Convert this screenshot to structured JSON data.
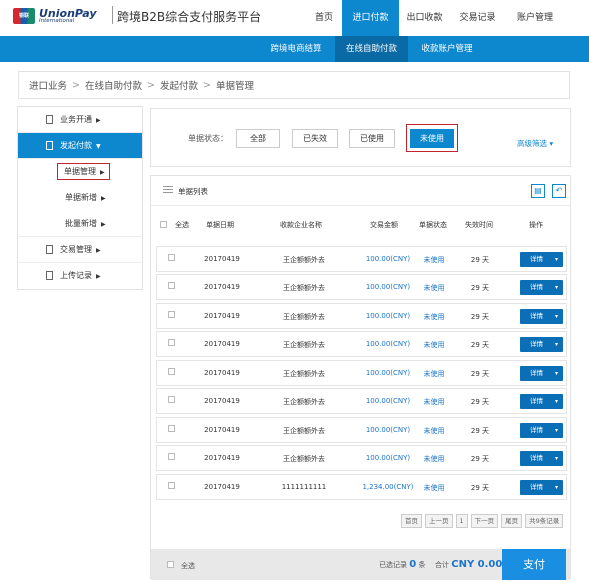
{
  "header": {
    "logo_badge": "银联",
    "logo_line1": "UnionPay",
    "logo_line2": "International",
    "site_title": "跨境B2B综合支付服务平台",
    "nav": [
      "首页",
      "进口付款",
      "出口收款",
      "交易记录",
      "账户管理"
    ],
    "active_nav": "进口付款"
  },
  "subnav": {
    "items": [
      "跨境电商结算",
      "在线自助付款",
      "收款账户管理"
    ],
    "active": "在线自助付款"
  },
  "breadcrumb": [
    "进口业务",
    "在线自助付款",
    "发起付款",
    "单据管理"
  ],
  "sidebar": {
    "items": [
      {
        "label": "业务开通",
        "caret": "▶"
      },
      {
        "label": "发起付款",
        "caret": "▼"
      },
      {
        "label": "单据管理",
        "caret": "▶"
      },
      {
        "label": "单据新增",
        "caret": "▶"
      },
      {
        "label": "批量新增",
        "caret": "▶"
      },
      {
        "label": "交易管理",
        "caret": "▶"
      },
      {
        "label": "上传记录",
        "caret": "▶"
      }
    ]
  },
  "filter": {
    "label": "单据状态：",
    "buttons": [
      "全部",
      "已失效",
      "已使用",
      "未使用"
    ],
    "selected": "未使用",
    "advanced": "高级筛选 ▾"
  },
  "table": {
    "title": "单据列表",
    "columns": [
      "全选",
      "单据日期",
      "收款企业名称",
      "交易金额",
      "单据状态",
      "失效时间",
      "操作"
    ],
    "rows": [
      {
        "date": "20170419",
        "payee": "王企额额外去",
        "amount": "100.00(CNY)",
        "status": "未使用",
        "expire": "29 天",
        "action": "详情"
      },
      {
        "date": "20170419",
        "payee": "王企额额外去",
        "amount": "100.00(CNY)",
        "status": "未使用",
        "expire": "29 天",
        "action": "详情"
      },
      {
        "date": "20170419",
        "payee": "王企额额外去",
        "amount": "100.00(CNY)",
        "status": "未使用",
        "expire": "29 天",
        "action": "详情"
      },
      {
        "date": "20170419",
        "payee": "王企额额外去",
        "amount": "100.00(CNY)",
        "status": "未使用",
        "expire": "29 天",
        "action": "详情"
      },
      {
        "date": "20170419",
        "payee": "王企额额外去",
        "amount": "100.00(CNY)",
        "status": "未使用",
        "expire": "29 天",
        "action": "详情"
      },
      {
        "date": "20170419",
        "payee": "王企额额外去",
        "amount": "100.00(CNY)",
        "status": "未使用",
        "expire": "29 天",
        "action": "详情"
      },
      {
        "date": "20170419",
        "payee": "王企额额外去",
        "amount": "100.00(CNY)",
        "status": "未使用",
        "expire": "29 天",
        "action": "详情"
      },
      {
        "date": "20170419",
        "payee": "王企额额外去",
        "amount": "100.00(CNY)",
        "status": "未使用",
        "expire": "29 天",
        "action": "详情"
      },
      {
        "date": "20170419",
        "payee": "1111111111",
        "amount": "1,234.00(CNY)",
        "status": "未使用",
        "expire": "29 天",
        "action": "详情"
      }
    ]
  },
  "pager": [
    "首页",
    "上一页",
    "1",
    "下一页",
    "尾页",
    "共9条记录"
  ],
  "footer": {
    "select_all": "全选",
    "selected_label": "已选记录",
    "selected_count": "0",
    "selected_unit": "条",
    "total_label": "合计",
    "total_value": "CNY 0.00",
    "pay_button": "支付"
  }
}
